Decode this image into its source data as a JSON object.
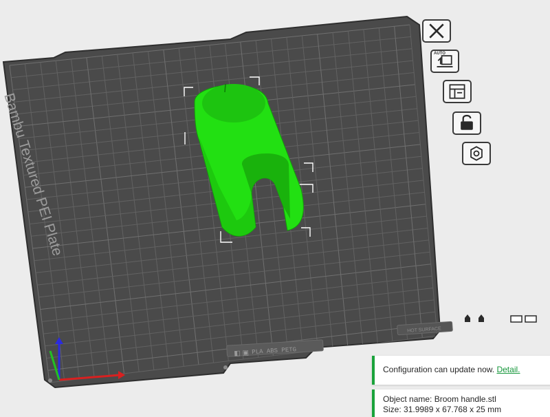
{
  "plate": {
    "label": "Bambu Textured PEI Plate",
    "filament_tag": "PLA ABS PETG",
    "hot_surface_tag": "HOT SURFACE"
  },
  "toolbar": [
    {
      "icon": "close-icon",
      "tag": ""
    },
    {
      "icon": "auto-orient-icon",
      "tag": "AUTO"
    },
    {
      "icon": "arrange-icon",
      "tag": ""
    },
    {
      "icon": "unlock-icon",
      "tag": ""
    },
    {
      "icon": "plate-settings-icon",
      "tag": ""
    }
  ],
  "notifications": {
    "config_text": "Configuration can update now.",
    "config_link": "Detail.",
    "object_name_label": "Object name:",
    "object_name": "Broom handle.stl",
    "size_label": "Size:",
    "size_value": "31.9989 x 67.768 x 25 mm"
  },
  "colors": {
    "background": "#ececec",
    "plate": "#4a4a4a",
    "grid": "#5f5f5f",
    "model": "#22e012",
    "accent": "#1aa33b"
  }
}
